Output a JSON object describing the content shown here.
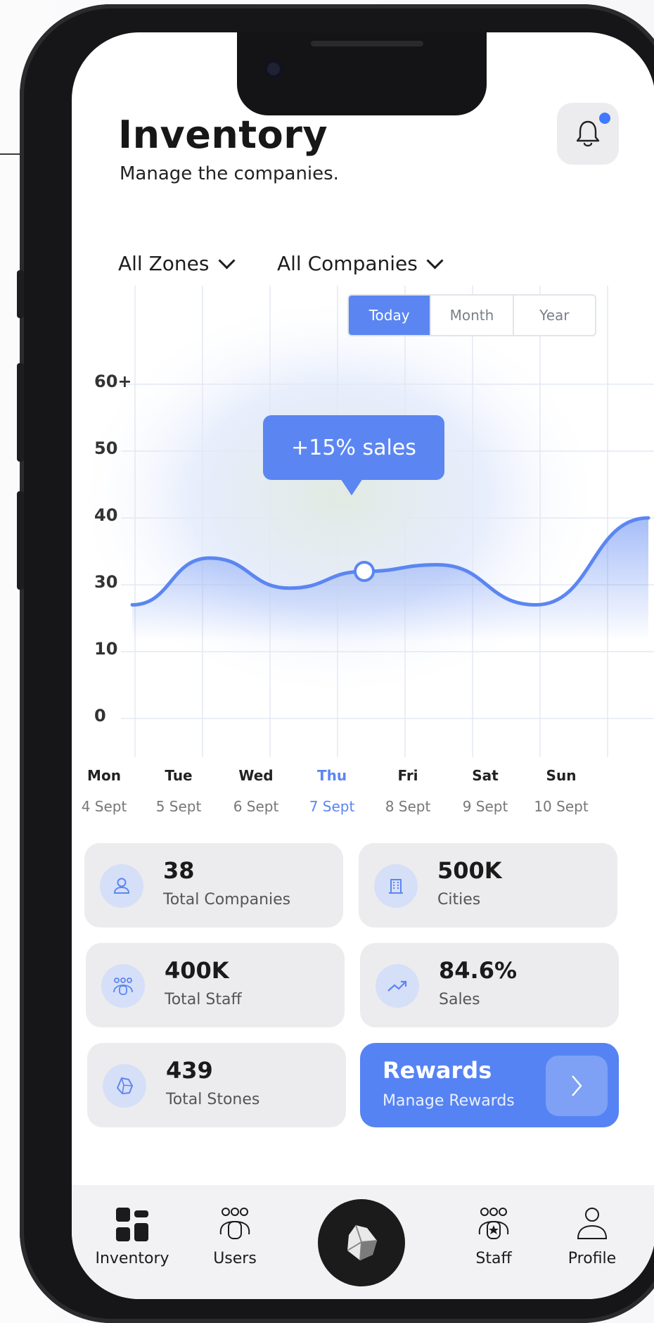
{
  "header": {
    "title": "Inventory",
    "subtitle": "Manage the companies.",
    "notification_icon": "bell-icon"
  },
  "filters": {
    "zones": "All Zones",
    "companies": "All Companies"
  },
  "periods": {
    "today": "Today",
    "month": "Month",
    "year": "Year",
    "selected": "Today"
  },
  "tooltip": "+15% sales",
  "chart_data": {
    "type": "area",
    "title": "",
    "xlabel": "",
    "ylabel": "",
    "y_tick_labels": [
      "60+",
      "50",
      "40",
      "30",
      "10",
      "0"
    ],
    "categories": [
      "Mon",
      "Tue",
      "Wed",
      "Thu",
      "Fri",
      "Sat",
      "Sun"
    ],
    "dates": [
      "4 Sept",
      "5 Sept",
      "6 Sept",
      "7 Sept",
      "8 Sept",
      "9 Sept",
      "10 Sept"
    ],
    "highlighted_index": 3,
    "series": [
      {
        "values": [
          24,
          34,
          29,
          32,
          33,
          24,
          40
        ]
      }
    ],
    "grid": true,
    "accent": "#5b86f2"
  },
  "stats": [
    {
      "value": "38",
      "label": "Total Companies",
      "icon": "user-icon"
    },
    {
      "value": "500K",
      "label": "Cities",
      "icon": "building-icon"
    },
    {
      "value": "400K",
      "label": "Total Staff",
      "icon": "team-icon"
    },
    {
      "value": "84.6%",
      "label": "Sales",
      "icon": "trend-up-icon"
    },
    {
      "value": "439",
      "label": "Total Stones",
      "icon": "stone-icon"
    }
  ],
  "rewards": {
    "title": "Rewards",
    "subtitle": "Manage Rewards",
    "icon": "chevron-right-icon"
  },
  "nav": {
    "inventory": "Inventory",
    "users": "Users",
    "center_icon": "stone-icon",
    "staff": "Staff",
    "profile": "Profile"
  },
  "colors": {
    "accent": "#5b86f2",
    "card_bg": "#ececee",
    "dark": "#1b1b1c"
  }
}
